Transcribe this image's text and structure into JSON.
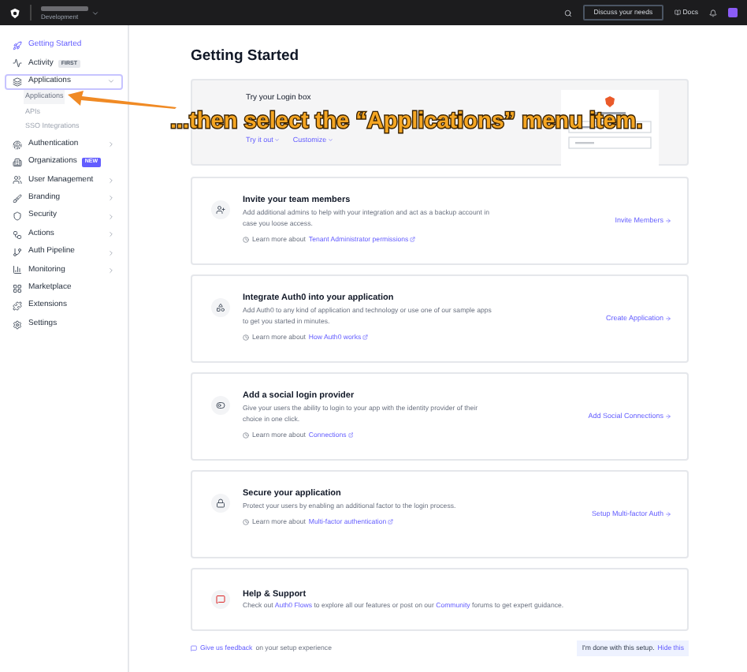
{
  "topbar": {
    "environment": "Development",
    "discuss_button": "Discuss your needs",
    "docs_link": "Docs"
  },
  "sidebar": {
    "items": [
      {
        "kind": "item",
        "label": "Getting Started",
        "selected": true
      },
      {
        "kind": "item",
        "label": "Activity",
        "badge": {
          "text": "FIRST",
          "highlighted": false
        }
      },
      {
        "kind": "group",
        "label": "Applications",
        "selected": false,
        "expanded": true,
        "children": [
          {
            "label": "Applications",
            "selected": true
          },
          {
            "label": "APIs",
            "selected": false
          },
          {
            "label": "SSO Integrations",
            "selected": false
          }
        ]
      },
      {
        "kind": "group",
        "label": "Authentication",
        "selected": false,
        "expanded": false
      },
      {
        "kind": "item",
        "label": "Organizations",
        "badge": {
          "text": "NEW",
          "highlighted": true
        }
      },
      {
        "kind": "group",
        "label": "User Management",
        "selected": false,
        "expanded": false
      },
      {
        "kind": "group",
        "label": "Branding",
        "selected": false,
        "expanded": false
      },
      {
        "kind": "group",
        "label": "Security",
        "selected": false,
        "expanded": false
      },
      {
        "kind": "group",
        "label": "Actions",
        "selected": false,
        "expanded": false
      },
      {
        "kind": "group",
        "label": "Auth Pipeline",
        "selected": false,
        "expanded": false
      },
      {
        "kind": "group",
        "label": "Monitoring",
        "selected": false,
        "expanded": false
      },
      {
        "kind": "item",
        "label": "Marketplace"
      },
      {
        "kind": "item",
        "label": "Extensions"
      },
      {
        "kind": "item",
        "label": "Settings"
      }
    ]
  },
  "page_title": "Getting Started",
  "login_box": {
    "title": "Try your Login box",
    "links": [
      "Try it out",
      "Customize"
    ]
  },
  "cards": [
    {
      "title": "Invite your team members",
      "description": "Add additional admins to help with your integration and act as a backup account in case you loose access.",
      "learn_prefix": "Learn more about",
      "learn_link": "Tenant Administrator permissions",
      "action": "Invite Members"
    },
    {
      "title": "Integrate Auth0 into your application",
      "description": "Add Auth0 to any kind of application and technology or use one of our sample apps to get you started in minutes.",
      "learn_prefix": "Learn more about",
      "learn_link": "How Auth0 works",
      "action": "Create Application"
    },
    {
      "title": "Add a social login provider",
      "description": "Give your users the ability to login to your app with the identity provider of their choice in one click.",
      "learn_prefix": "Learn more about",
      "learn_link": "Connections",
      "action": "Add Social Connections"
    },
    {
      "title": "Secure your application",
      "description": "Protect your users by enabling an additional factor to the login process.",
      "learn_prefix": "Learn more about",
      "learn_link": "Multi-factor authentication",
      "action": "Setup Multi-factor Auth"
    }
  ],
  "help": {
    "title": "Help & Support",
    "parts": [
      {
        "text": "Check out",
        "link": false
      },
      {
        "text": "Auth0 Flows",
        "link": true
      },
      {
        "text": "to explore all our features or post on our",
        "link": false
      },
      {
        "text": "Community",
        "link": true
      },
      {
        "text": "forums to get expert guidance.",
        "link": false
      }
    ]
  },
  "footer": {
    "feedback_link": "Give us feedback",
    "feedback_text": "on your setup experience",
    "done_text": "I'm done with this setup.",
    "hide_link": "Hide this"
  },
  "annotation": {
    "text": "...then select the “Applications” menu item."
  }
}
